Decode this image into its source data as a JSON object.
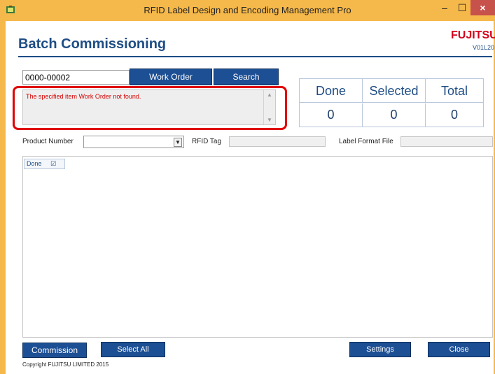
{
  "window": {
    "title": "RFID Label Design and Encoding Management Pro",
    "minimize_glyph": "–",
    "maximize_glyph": "☐",
    "close_glyph": "×"
  },
  "header": {
    "title": "Batch Commissioning",
    "brand": "FUJITSU",
    "version": "V01L20"
  },
  "work_order": {
    "input_value": "0000-00002",
    "work_order_button": "Work Order",
    "search_button": "Search"
  },
  "message": {
    "text": "The specified item Work Order not found.",
    "scroll_up_glyph": "▲",
    "scroll_down_glyph": "▼"
  },
  "stats": {
    "done_label": "Done",
    "selected_label": "Selected",
    "total_label": "Total",
    "done_value": "0",
    "selected_value": "0",
    "total_value": "0"
  },
  "filters": {
    "product_number_label": "Product Number",
    "product_number_value": "",
    "dropdown_glyph": "▼",
    "rfid_tag_label": "RFID Tag",
    "rfid_tag_value": "",
    "label_format_label": "Label Format File",
    "label_format_value": ""
  },
  "grid": {
    "done_header": "Done",
    "check_glyph": "☑"
  },
  "footer": {
    "commission_button": "Commission",
    "select_all_button": "Select All",
    "settings_button": "Settings",
    "close_button": "Close",
    "copyright": "Copyright FUJITSU LIMITED 2015"
  },
  "colors": {
    "titlebar": "#f5b84a",
    "accent": "#1e4d85",
    "button": "#1d4f94",
    "error_text": "#d40000",
    "highlight": "#e00000"
  }
}
